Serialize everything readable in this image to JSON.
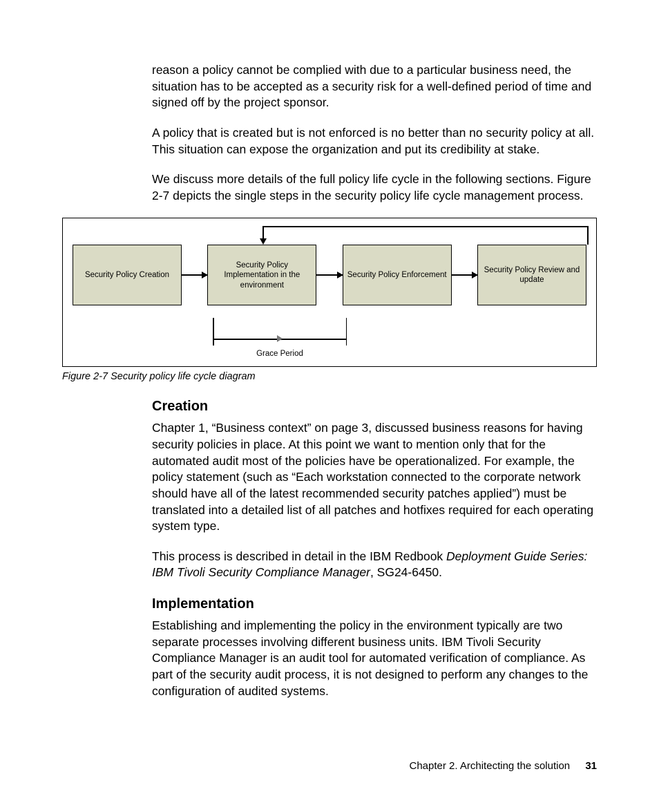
{
  "paragraphs": {
    "p1": "reason a policy cannot be complied with due to a particular business need, the situation has to be accepted as a security risk for a well-defined period of time and signed off by the project sponsor.",
    "p2": "A policy that is created but is not enforced is no better than no security policy at all. This situation can expose the organization and put its credibility at stake.",
    "p3": "We discuss more details of the full policy life cycle in the following sections. Figure 2-7 depicts the single steps in the security policy life cycle management process."
  },
  "diagram": {
    "box1": "Security Policy Creation",
    "box2": "Security Policy Implementation in the environment",
    "box3": "Security Policy Enforcement",
    "box4": "Security Policy Review and update",
    "grace": "Grace Period"
  },
  "caption": "Figure 2-7   Security policy life cycle diagram",
  "sections": {
    "creation": {
      "heading": "Creation",
      "p1": "Chapter 1, “Business context” on page 3, discussed business reasons for having security policies in place. At this point we want to mention only that for the automated audit most of the policies have be operationalized. For example, the policy statement (such as “Each workstation connected to the corporate network should have all of the latest recommended security patches applied”) must be translated into a detailed list of all patches and hotfixes required for each operating system type.",
      "p2_pre": "This process is described in detail in the IBM Redbook ",
      "p2_ref": "Deployment Guide Series: IBM Tivoli Security Compliance Manager",
      "p2_post": ", SG24-6450."
    },
    "implementation": {
      "heading": "Implementation",
      "p1": "Establishing and implementing the policy in the environment typically are two separate processes involving different business units. IBM Tivoli Security Compliance Manager is an audit tool for automated verification of compliance. As part of the security audit process, it is not designed to perform any changes to the configuration of audited systems."
    }
  },
  "footer": {
    "chapter": "Chapter 2. Architecting the solution",
    "page": "31"
  }
}
